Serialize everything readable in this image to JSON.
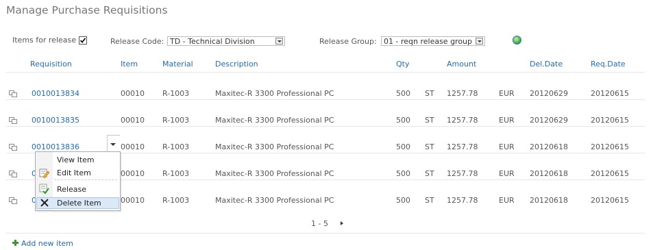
{
  "page": {
    "title": "Manage Purchase Requisitions"
  },
  "filters": {
    "items_for_release_label": "Items for release",
    "items_for_release_checked": true,
    "release_code_label": "Release Code:",
    "release_code_value": "TD - Technical Division",
    "release_group_label": "Release Group:",
    "release_group_value": "01 - reqn release group"
  },
  "table": {
    "headers": {
      "requisition": "Requisition",
      "item": "Item",
      "material": "Material",
      "description": "Description",
      "qty": "Qty",
      "amount": "Amount",
      "del_date": "Del.Date",
      "req_date": "Req.Date"
    },
    "rows": [
      {
        "requisition": "0010013834",
        "item": "00010",
        "material": "R-1003",
        "description": "Maxitec-R 3300 Professional PC",
        "qty": "500",
        "unit": "ST",
        "amount": "1257.78",
        "currency": "EUR",
        "del_date": "20120629",
        "req_date": "20120615"
      },
      {
        "requisition": "0010013835",
        "item": "00010",
        "material": "R-1003",
        "description": "Maxitec-R 3300 Professional PC",
        "qty": "500",
        "unit": "ST",
        "amount": "1257.78",
        "currency": "EUR",
        "del_date": "20120629",
        "req_date": "20120615"
      },
      {
        "requisition": "0010013836",
        "item": "00010",
        "material": "R-1003",
        "description": "Maxitec-R 3300 Professional PC",
        "qty": "500",
        "unit": "ST",
        "amount": "1257.78",
        "currency": "EUR",
        "del_date": "20120618",
        "req_date": "20120615"
      },
      {
        "requisition": "0",
        "item": "00010",
        "material": "R-1003",
        "description": "Maxitec-R 3300 Professional PC",
        "qty": "500",
        "unit": "ST",
        "amount": "1257.78",
        "currency": "EUR",
        "del_date": "20120618",
        "req_date": "20120615"
      },
      {
        "requisition": "0",
        "item": "00010",
        "material": "R-1003",
        "description": "Maxitec-R 3300 Professional PC",
        "qty": "500",
        "unit": "ST",
        "amount": "1257.78",
        "currency": "EUR",
        "del_date": "20120618",
        "req_date": "20120615"
      }
    ]
  },
  "context_menu": {
    "items": [
      {
        "label": "View Item",
        "icon": "none"
      },
      {
        "label": "Edit Item",
        "icon": "edit-icon"
      },
      {
        "label": "Release",
        "icon": "release-icon"
      },
      {
        "label": "Delete Item",
        "icon": "delete-icon",
        "highlighted": true
      }
    ]
  },
  "pager": {
    "range": "1 - 5"
  },
  "footer": {
    "add_new_item": "Add new item"
  },
  "colors": {
    "link": "#1f6bb5",
    "highlight": "#dbe9f7",
    "add_icon": "#3b9a2e"
  }
}
